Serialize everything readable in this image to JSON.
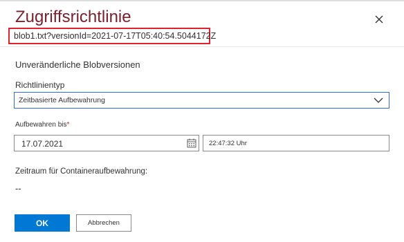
{
  "dialog": {
    "title": "Zugriffsrichtlinie",
    "subtitle": "blob1.txt?versionId=2021-07-17T05:40:54.5044172Z",
    "close_icon": "close-icon"
  },
  "section": {
    "heading": "Unveränderliche Blobversionen"
  },
  "policy_type": {
    "label": "Richtlinientyp",
    "selected": "Zeitbasierte Aufbewahrung",
    "dropdown_icon": "chevron-down-icon"
  },
  "retain_until": {
    "label": "Aufbewahren bis",
    "required_marker": "*",
    "date": "17.07.2021",
    "time": "22:47:32 Uhr",
    "calendar_icon": "calendar-icon"
  },
  "container_retention": {
    "label": "Zeitraum für Containeraufbewahrung:",
    "value": "--"
  },
  "buttons": {
    "ok": "OK",
    "cancel": "Abbrechen"
  },
  "colors": {
    "title": "#7a1f2b",
    "highlight_border": "#e0202e",
    "primary": "#0078d4",
    "focus_border": "#2b6ed6"
  }
}
